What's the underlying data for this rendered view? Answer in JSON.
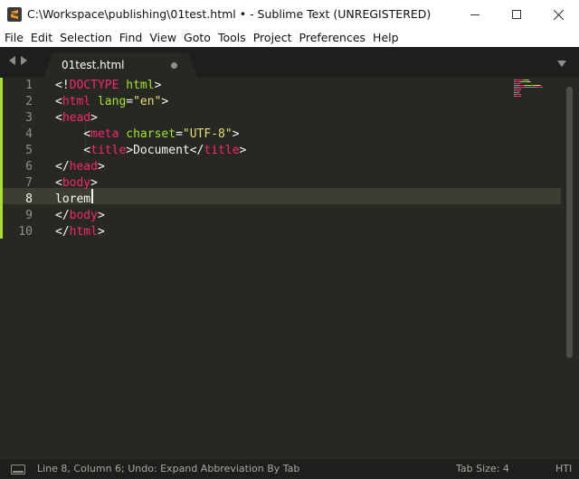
{
  "window": {
    "title": "C:\\Workspace\\publishing\\01test.html • - Sublime Text (UNREGISTERED)"
  },
  "menu": [
    "File",
    "Edit",
    "Selection",
    "Find",
    "View",
    "Goto",
    "Tools",
    "Project",
    "Preferences",
    "Help"
  ],
  "tab": {
    "label": "01test.html",
    "dirty": true
  },
  "editor": {
    "line_numbers": [
      "1",
      "2",
      "3",
      "4",
      "5",
      "6",
      "7",
      "8",
      "9",
      "10"
    ],
    "current_line": 8,
    "lines": [
      [
        {
          "t": "<!",
          "c": "txt"
        },
        {
          "t": "DOCTYPE",
          "c": "tag"
        },
        {
          "t": " ",
          "c": "txt"
        },
        {
          "t": "html",
          "c": "attr"
        },
        {
          "t": ">",
          "c": "txt"
        }
      ],
      [
        {
          "t": "<",
          "c": "txt"
        },
        {
          "t": "html",
          "c": "tag"
        },
        {
          "t": " ",
          "c": "txt"
        },
        {
          "t": "lang",
          "c": "attr"
        },
        {
          "t": "=",
          "c": "txt"
        },
        {
          "t": "\"en\"",
          "c": "str"
        },
        {
          "t": ">",
          "c": "txt"
        }
      ],
      [
        {
          "t": "<",
          "c": "txt"
        },
        {
          "t": "head",
          "c": "tag"
        },
        {
          "t": ">",
          "c": "txt"
        }
      ],
      [
        {
          "t": "    <",
          "c": "txt"
        },
        {
          "t": "meta",
          "c": "tag"
        },
        {
          "t": " ",
          "c": "txt"
        },
        {
          "t": "charset",
          "c": "attr"
        },
        {
          "t": "=",
          "c": "txt"
        },
        {
          "t": "\"UTF-8\"",
          "c": "str"
        },
        {
          "t": ">",
          "c": "txt"
        }
      ],
      [
        {
          "t": "    <",
          "c": "txt"
        },
        {
          "t": "title",
          "c": "tag"
        },
        {
          "t": ">",
          "c": "txt"
        },
        {
          "t": "Document",
          "c": "txt"
        },
        {
          "t": "</",
          "c": "txt"
        },
        {
          "t": "title",
          "c": "tag"
        },
        {
          "t": ">",
          "c": "txt"
        }
      ],
      [
        {
          "t": "</",
          "c": "txt"
        },
        {
          "t": "head",
          "c": "tag"
        },
        {
          "t": ">",
          "c": "txt"
        }
      ],
      [
        {
          "t": "<",
          "c": "txt"
        },
        {
          "t": "body",
          "c": "tag"
        },
        {
          "t": ">",
          "c": "txt"
        }
      ],
      [
        {
          "t": "lorem",
          "c": "txt"
        }
      ],
      [
        {
          "t": "</",
          "c": "txt"
        },
        {
          "t": "body",
          "c": "tag"
        },
        {
          "t": ">",
          "c": "txt"
        }
      ],
      [
        {
          "t": "</",
          "c": "txt"
        },
        {
          "t": "html",
          "c": "tag"
        },
        {
          "t": ">",
          "c": "txt"
        }
      ]
    ]
  },
  "status": {
    "position": "Line 8, Column 6; Undo: Expand Abbreviation By Tab",
    "tab_size": "Tab Size: 4",
    "syntax": "HTI"
  },
  "colors": {
    "background": "#272822",
    "tag": "#f92672",
    "attribute": "#a6e22e",
    "string": "#e6db74",
    "text": "#f8f8f2",
    "line_highlight": "#3e3d32",
    "modified_bar": "#a6e22e"
  }
}
